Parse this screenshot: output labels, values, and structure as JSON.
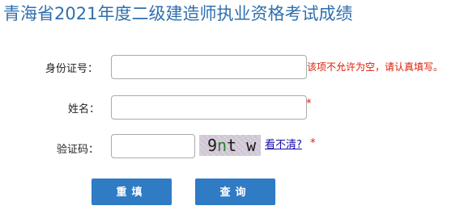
{
  "page": {
    "title": "青海省2021年度二级建造师执业资格考试成绩"
  },
  "form": {
    "id_label": "身份证号：",
    "id_value": "",
    "id_error": "该项不允许为空，请认真填写。",
    "name_label": "姓名：",
    "name_value": "",
    "name_required": "*",
    "captcha_label": "验证码：",
    "captcha_value": "",
    "captcha_image_text": [
      "9",
      "n",
      "t",
      " w"
    ],
    "captcha_refresh": "看不清?",
    "captcha_required": "*"
  },
  "buttons": {
    "reset_label": "重填",
    "query_label": "查询"
  },
  "colors": {
    "title": "#2f6fae",
    "error": "#d81e06",
    "button_bg": "#2f7bc4",
    "link": "#1a0dab"
  }
}
